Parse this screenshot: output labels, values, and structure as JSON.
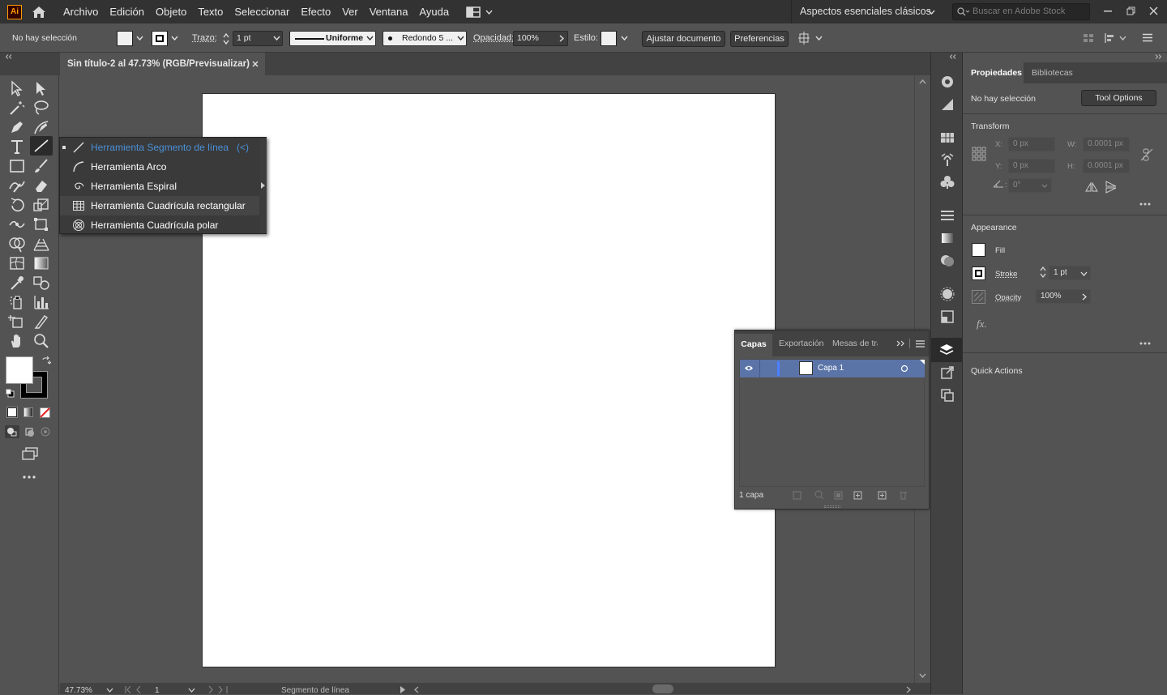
{
  "app": {
    "logo": "Ai"
  },
  "menu": [
    "Archivo",
    "Edición",
    "Objeto",
    "Texto",
    "Seleccionar",
    "Efecto",
    "Ver",
    "Ventana",
    "Ayuda"
  ],
  "workspace": "Aspectos esenciales clásicos",
  "search_placeholder": "Buscar en Adobe Stock",
  "control": {
    "selection": "No hay selección",
    "stroke_label": "Trazo:",
    "stroke_value": "1 pt",
    "profile": "Uniforme",
    "brush": "Redondo 5 ...",
    "opacity_label": "Opacidad:",
    "opacity_value": "100%",
    "style_label": "Estilo:",
    "fit_button": "Ajustar documento",
    "prefs_button": "Preferencias"
  },
  "document_tab": "Sin título-2 al 47.73% (RGB/Previsualizar)",
  "flyout": {
    "items": [
      {
        "label": "Herramienta Segmento de línea",
        "shortcut": "(<)"
      },
      {
        "label": "Herramienta Arco"
      },
      {
        "label": "Herramienta Espiral"
      },
      {
        "label": "Herramienta Cuadrícula rectangular"
      },
      {
        "label": "Herramienta Cuadrícula polar"
      }
    ]
  },
  "status": {
    "zoom": "47.73%",
    "artboard": "1",
    "tool": "Segmento de línea"
  },
  "properties": {
    "tab_properties": "Propiedades",
    "tab_libraries": "Bibliotecas",
    "selection": "No hay selección",
    "tool_options": "Tool Options",
    "transform_title": "Transform",
    "x_label": "X:",
    "x_value": "0 px",
    "y_label": "Y:",
    "y_value": "0 px",
    "w_label": "W:",
    "w_value": "0.0001 px",
    "h_label": "H:",
    "h_value": "0.0001 px",
    "angle_value": "0°",
    "appearance_title": "Appearance",
    "fill_label": "Fill",
    "stroke_label": "Stroke",
    "stroke_value": "1 pt",
    "opacity_label": "Opacity",
    "opacity_value": "100%",
    "fx": "fx.",
    "quick_actions": "Quick Actions"
  },
  "layers": {
    "tabs": [
      "Capas",
      "Exportación",
      "Mesas de tra"
    ],
    "layer_name": "Capa 1",
    "count": "1 capa"
  },
  "colors": {
    "accent": "#4a90d9",
    "layer_highlight": "#5b74a8",
    "panel": "#535353",
    "dark": "#323232"
  }
}
